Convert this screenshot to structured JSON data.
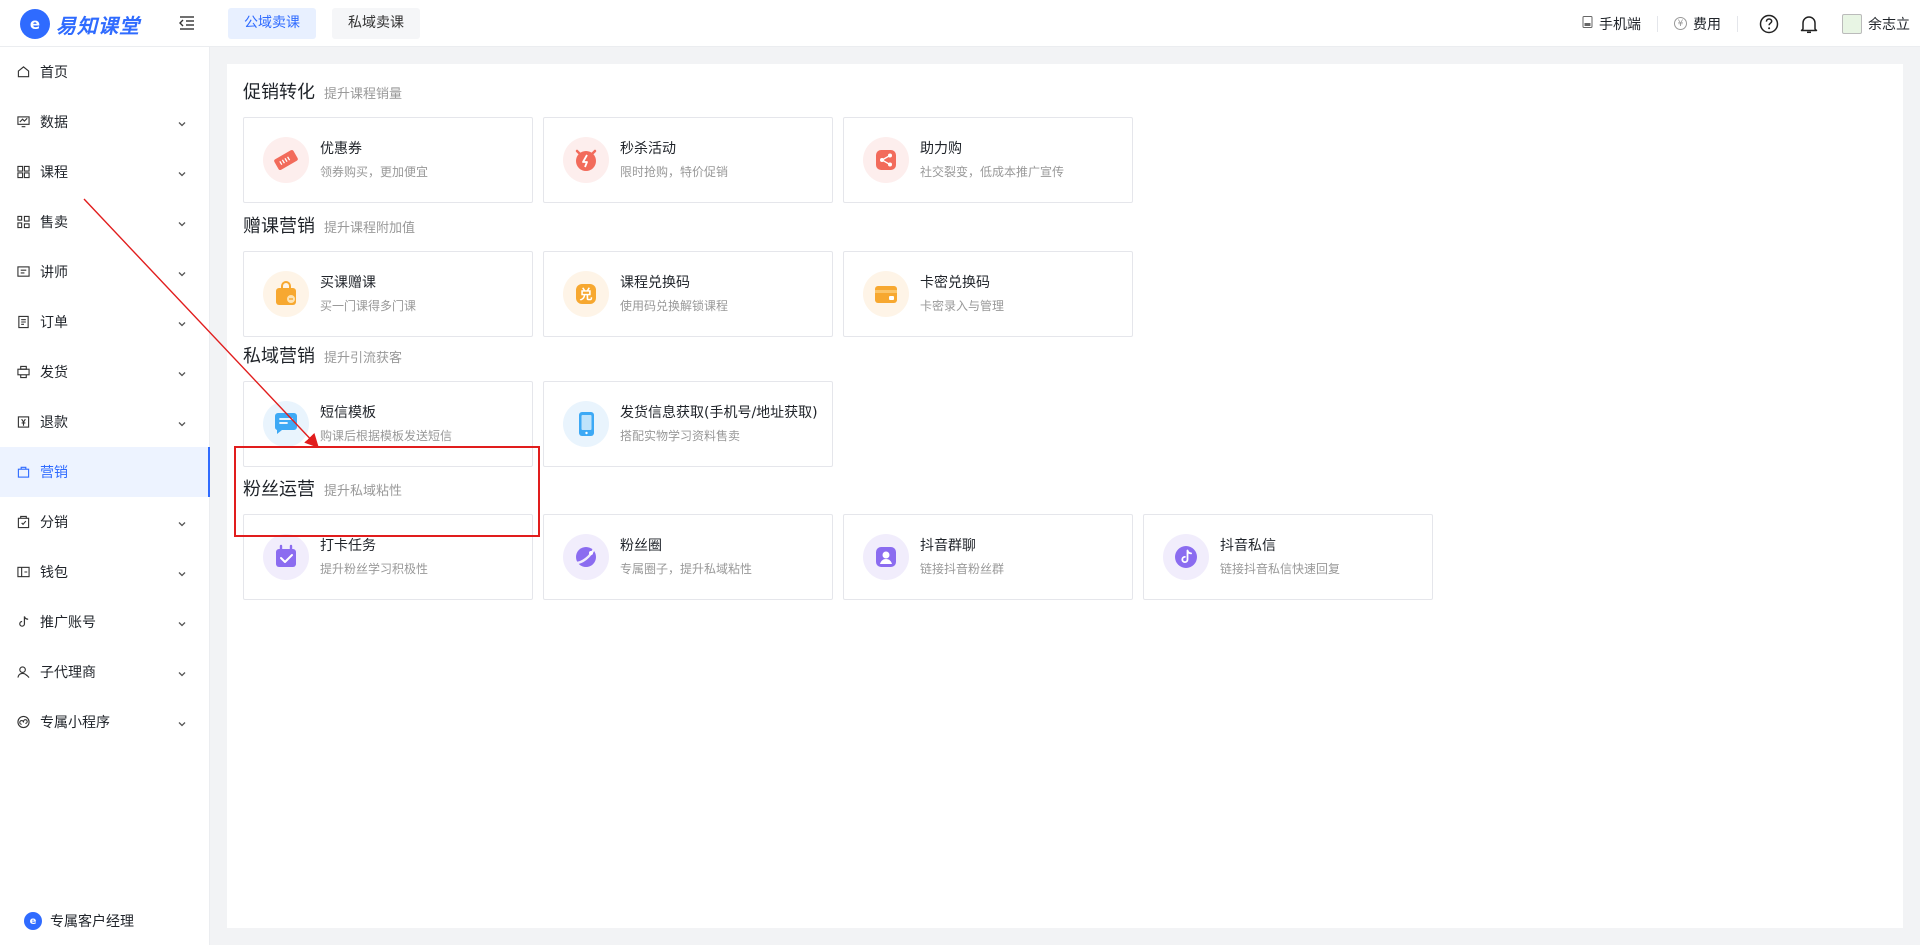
{
  "header": {
    "logo_mark": "e",
    "logo_text": "易知课堂",
    "tabs": [
      {
        "label": "公域卖课",
        "active": true
      },
      {
        "label": "私域卖课",
        "active": false
      }
    ],
    "mobile_label": "手机端",
    "fee_label": "费用",
    "fee_icon": "¥",
    "username": "余志立"
  },
  "sidebar": {
    "items": [
      {
        "label": "首页",
        "icon": "home-icon",
        "chevron": false
      },
      {
        "label": "数据",
        "icon": "data-icon",
        "chevron": true
      },
      {
        "label": "课程",
        "icon": "course-icon",
        "chevron": true
      },
      {
        "label": "售卖",
        "icon": "sale-icon",
        "chevron": true
      },
      {
        "label": "讲师",
        "icon": "teacher-icon",
        "chevron": true
      },
      {
        "label": "订单",
        "icon": "order-icon",
        "chevron": true
      },
      {
        "label": "发货",
        "icon": "ship-icon",
        "chevron": true
      },
      {
        "label": "退款",
        "icon": "refund-icon",
        "chevron": true
      },
      {
        "label": "营销",
        "icon": "marketing-icon",
        "chevron": false,
        "active": true
      },
      {
        "label": "分销",
        "icon": "distribution-icon",
        "chevron": true
      },
      {
        "label": "钱包",
        "icon": "wallet-icon",
        "chevron": true
      },
      {
        "label": "推广账号",
        "icon": "promo-account-icon",
        "chevron": true
      },
      {
        "label": "子代理商",
        "icon": "sub-agent-icon",
        "chevron": true
      },
      {
        "label": "专属小程序",
        "icon": "miniprogram-icon",
        "chevron": true
      }
    ],
    "footer_label": "专属客户经理"
  },
  "sections": [
    {
      "title": "促销转化",
      "subtitle": "提升课程销量",
      "cards": [
        {
          "title": "优惠券",
          "desc": "领券购买，更加便宜",
          "icon": "coupon-icon",
          "color": "#f26b5b"
        },
        {
          "title": "秒杀活动",
          "desc": "限时抢购，特价促销",
          "icon": "alarm-clock-icon",
          "color": "#f26b5b"
        },
        {
          "title": "助力购",
          "desc": "社交裂变，低成本推广宣传",
          "icon": "share-icon",
          "color": "#f26b5b"
        }
      ]
    },
    {
      "title": "赠课营销",
      "subtitle": "提升课程附加值",
      "cards": [
        {
          "title": "买课赠课",
          "desc": "买一门课得多门课",
          "icon": "gift-bag-icon",
          "color": "#f7a830"
        },
        {
          "title": "课程兑换码",
          "desc": "使用码兑换解锁课程",
          "icon": "redeem-icon",
          "color": "#f7a830"
        },
        {
          "title": "卡密兑换码",
          "desc": "卡密录入与管理",
          "icon": "card-wallet-icon",
          "color": "#f7a830"
        }
      ]
    },
    {
      "title": "私域营销",
      "subtitle": "提升引流获客",
      "cards": [
        {
          "title": "短信模板",
          "desc": "购课后根据模板发送短信",
          "icon": "sms-icon",
          "color": "#3da9f5"
        },
        {
          "title": "发货信息获取(手机号/地址获取)",
          "desc": "搭配实物学习资料售卖",
          "icon": "phone-icon",
          "color": "#3da9f5"
        }
      ]
    },
    {
      "title": "粉丝运营",
      "subtitle": "提升私域粘性",
      "cards": [
        {
          "title": "打卡任务",
          "desc": "提升粉丝学习积极性",
          "icon": "checkin-icon",
          "color": "#8b6cf0"
        },
        {
          "title": "粉丝圈",
          "desc": "专属圈子，提升私域粘性",
          "icon": "fan-circle-icon",
          "color": "#8b6cf0"
        },
        {
          "title": "抖音群聊",
          "desc": "链接抖音粉丝群",
          "icon": "douyin-group-icon",
          "color": "#8b6cf0"
        },
        {
          "title": "抖音私信",
          "desc": "链接抖音私信快速回复",
          "icon": "douyin-message-icon",
          "color": "#8b6cf0"
        }
      ]
    }
  ],
  "annotation": {
    "highlight_color": "#e11d1d"
  }
}
